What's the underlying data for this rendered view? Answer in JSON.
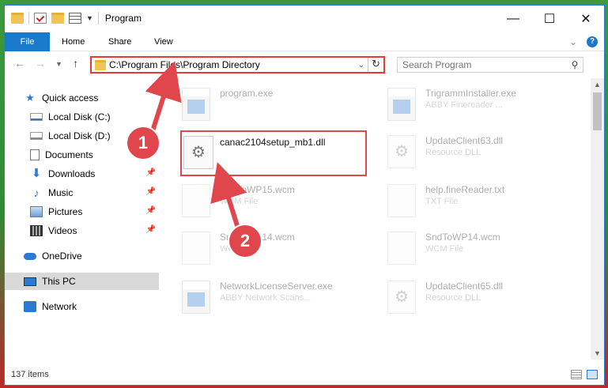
{
  "window": {
    "title": "Program"
  },
  "ribbon": {
    "tabs": [
      "File",
      "Home",
      "Share",
      "View"
    ]
  },
  "window_controls": {
    "minimize": "—",
    "maximize": "☐",
    "close": "✕"
  },
  "address": {
    "path": "C:\\Program Files\\Program Directory"
  },
  "search": {
    "placeholder": "Search Program"
  },
  "sidebar": {
    "items": [
      {
        "label": "Quick access",
        "icon": "star-icon"
      },
      {
        "label": "Local Disk (C:)",
        "icon": "drive-icon"
      },
      {
        "label": "Local Disk (D:)",
        "icon": "drive-icon"
      },
      {
        "label": "Documents",
        "icon": "documents-icon",
        "pinned": true
      },
      {
        "label": "Downloads",
        "icon": "download-icon",
        "pinned": true
      },
      {
        "label": "Music",
        "icon": "music-icon",
        "pinned": true
      },
      {
        "label": "Pictures",
        "icon": "pictures-icon",
        "pinned": true
      },
      {
        "label": "Videos",
        "icon": "videos-icon",
        "pinned": true
      },
      {
        "label": "OneDrive",
        "icon": "cloud-icon"
      },
      {
        "label": "This PC",
        "icon": "computer-icon",
        "selected": true
      },
      {
        "label": "Network",
        "icon": "network-icon"
      }
    ]
  },
  "files": [
    {
      "name": "program.exe",
      "type": "",
      "icon": "exe-icon",
      "faded": true
    },
    {
      "name": "TrigrammInstaller.exe",
      "type": "ABBY Finereader ...",
      "icon": "exe-icon",
      "faded": true
    },
    {
      "name": "canac2104setup_mb1.dll",
      "type": "",
      "icon": "dll-gear-icon",
      "highlighted": true
    },
    {
      "name": "UpdateClient63.dll",
      "type": "Resource DLL",
      "icon": "dll-gear-icon",
      "faded": true
    },
    {
      "name": "SndToWP15.wcm",
      "type": "WCM File",
      "icon": "file-icon",
      "faded": true
    },
    {
      "name": "help.fineReader.txt",
      "type": "TXT File",
      "icon": "file-icon",
      "faded": true
    },
    {
      "name": "SndToWP14.wcm",
      "type": "WCM File",
      "icon": "file-icon",
      "faded": true
    },
    {
      "name": "SndToWP14.wcm",
      "type": "WCM File",
      "icon": "file-icon",
      "faded": true
    },
    {
      "name": "NetworkLicenseServer.exe",
      "type": "ABBY Network Scans...",
      "icon": "exe-icon",
      "faded": true
    },
    {
      "name": "UpdateClient65.dll",
      "type": "Resource DLL",
      "icon": "dll-gear-icon",
      "faded": true
    }
  ],
  "status": {
    "item_count": "137 items"
  },
  "annotations": {
    "step1": "1",
    "step2": "2",
    "color": "#e0474c"
  }
}
